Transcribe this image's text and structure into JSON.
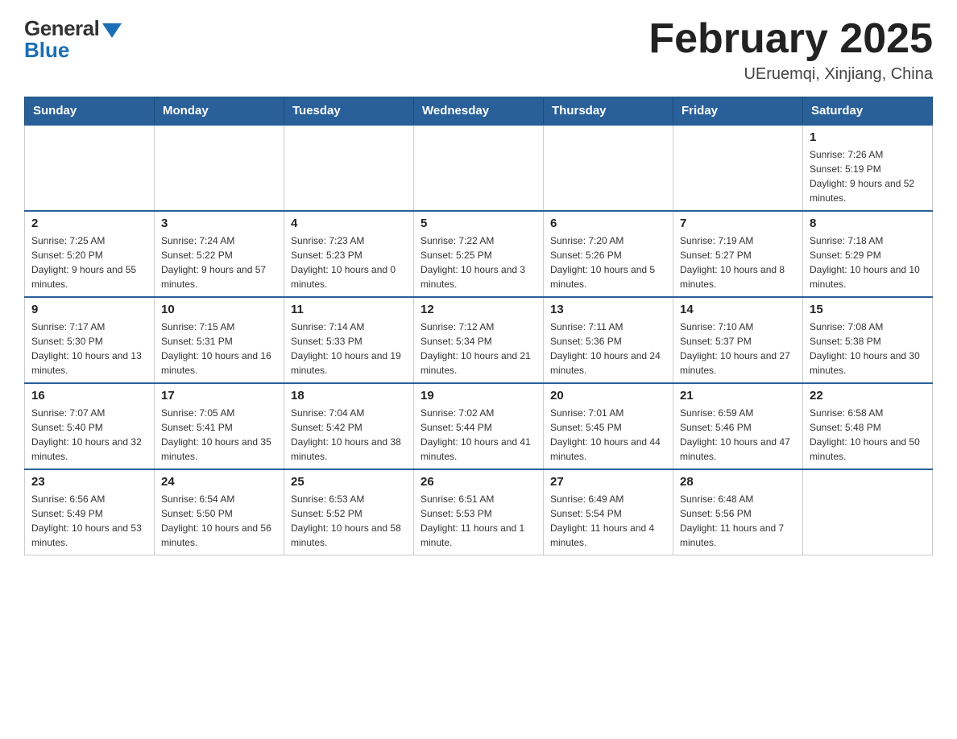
{
  "header": {
    "logo_general": "General",
    "logo_blue": "Blue",
    "month_title": "February 2025",
    "location": "UEruemqi, Xinjiang, China"
  },
  "weekdays": [
    "Sunday",
    "Monday",
    "Tuesday",
    "Wednesday",
    "Thursday",
    "Friday",
    "Saturday"
  ],
  "weeks": [
    [
      {
        "day": "",
        "info": ""
      },
      {
        "day": "",
        "info": ""
      },
      {
        "day": "",
        "info": ""
      },
      {
        "day": "",
        "info": ""
      },
      {
        "day": "",
        "info": ""
      },
      {
        "day": "",
        "info": ""
      },
      {
        "day": "1",
        "info": "Sunrise: 7:26 AM\nSunset: 5:19 PM\nDaylight: 9 hours and 52 minutes."
      }
    ],
    [
      {
        "day": "2",
        "info": "Sunrise: 7:25 AM\nSunset: 5:20 PM\nDaylight: 9 hours and 55 minutes."
      },
      {
        "day": "3",
        "info": "Sunrise: 7:24 AM\nSunset: 5:22 PM\nDaylight: 9 hours and 57 minutes."
      },
      {
        "day": "4",
        "info": "Sunrise: 7:23 AM\nSunset: 5:23 PM\nDaylight: 10 hours and 0 minutes."
      },
      {
        "day": "5",
        "info": "Sunrise: 7:22 AM\nSunset: 5:25 PM\nDaylight: 10 hours and 3 minutes."
      },
      {
        "day": "6",
        "info": "Sunrise: 7:20 AM\nSunset: 5:26 PM\nDaylight: 10 hours and 5 minutes."
      },
      {
        "day": "7",
        "info": "Sunrise: 7:19 AM\nSunset: 5:27 PM\nDaylight: 10 hours and 8 minutes."
      },
      {
        "day": "8",
        "info": "Sunrise: 7:18 AM\nSunset: 5:29 PM\nDaylight: 10 hours and 10 minutes."
      }
    ],
    [
      {
        "day": "9",
        "info": "Sunrise: 7:17 AM\nSunset: 5:30 PM\nDaylight: 10 hours and 13 minutes."
      },
      {
        "day": "10",
        "info": "Sunrise: 7:15 AM\nSunset: 5:31 PM\nDaylight: 10 hours and 16 minutes."
      },
      {
        "day": "11",
        "info": "Sunrise: 7:14 AM\nSunset: 5:33 PM\nDaylight: 10 hours and 19 minutes."
      },
      {
        "day": "12",
        "info": "Sunrise: 7:12 AM\nSunset: 5:34 PM\nDaylight: 10 hours and 21 minutes."
      },
      {
        "day": "13",
        "info": "Sunrise: 7:11 AM\nSunset: 5:36 PM\nDaylight: 10 hours and 24 minutes."
      },
      {
        "day": "14",
        "info": "Sunrise: 7:10 AM\nSunset: 5:37 PM\nDaylight: 10 hours and 27 minutes."
      },
      {
        "day": "15",
        "info": "Sunrise: 7:08 AM\nSunset: 5:38 PM\nDaylight: 10 hours and 30 minutes."
      }
    ],
    [
      {
        "day": "16",
        "info": "Sunrise: 7:07 AM\nSunset: 5:40 PM\nDaylight: 10 hours and 32 minutes."
      },
      {
        "day": "17",
        "info": "Sunrise: 7:05 AM\nSunset: 5:41 PM\nDaylight: 10 hours and 35 minutes."
      },
      {
        "day": "18",
        "info": "Sunrise: 7:04 AM\nSunset: 5:42 PM\nDaylight: 10 hours and 38 minutes."
      },
      {
        "day": "19",
        "info": "Sunrise: 7:02 AM\nSunset: 5:44 PM\nDaylight: 10 hours and 41 minutes."
      },
      {
        "day": "20",
        "info": "Sunrise: 7:01 AM\nSunset: 5:45 PM\nDaylight: 10 hours and 44 minutes."
      },
      {
        "day": "21",
        "info": "Sunrise: 6:59 AM\nSunset: 5:46 PM\nDaylight: 10 hours and 47 minutes."
      },
      {
        "day": "22",
        "info": "Sunrise: 6:58 AM\nSunset: 5:48 PM\nDaylight: 10 hours and 50 minutes."
      }
    ],
    [
      {
        "day": "23",
        "info": "Sunrise: 6:56 AM\nSunset: 5:49 PM\nDaylight: 10 hours and 53 minutes."
      },
      {
        "day": "24",
        "info": "Sunrise: 6:54 AM\nSunset: 5:50 PM\nDaylight: 10 hours and 56 minutes."
      },
      {
        "day": "25",
        "info": "Sunrise: 6:53 AM\nSunset: 5:52 PM\nDaylight: 10 hours and 58 minutes."
      },
      {
        "day": "26",
        "info": "Sunrise: 6:51 AM\nSunset: 5:53 PM\nDaylight: 11 hours and 1 minute."
      },
      {
        "day": "27",
        "info": "Sunrise: 6:49 AM\nSunset: 5:54 PM\nDaylight: 11 hours and 4 minutes."
      },
      {
        "day": "28",
        "info": "Sunrise: 6:48 AM\nSunset: 5:56 PM\nDaylight: 11 hours and 7 minutes."
      },
      {
        "day": "",
        "info": ""
      }
    ]
  ]
}
